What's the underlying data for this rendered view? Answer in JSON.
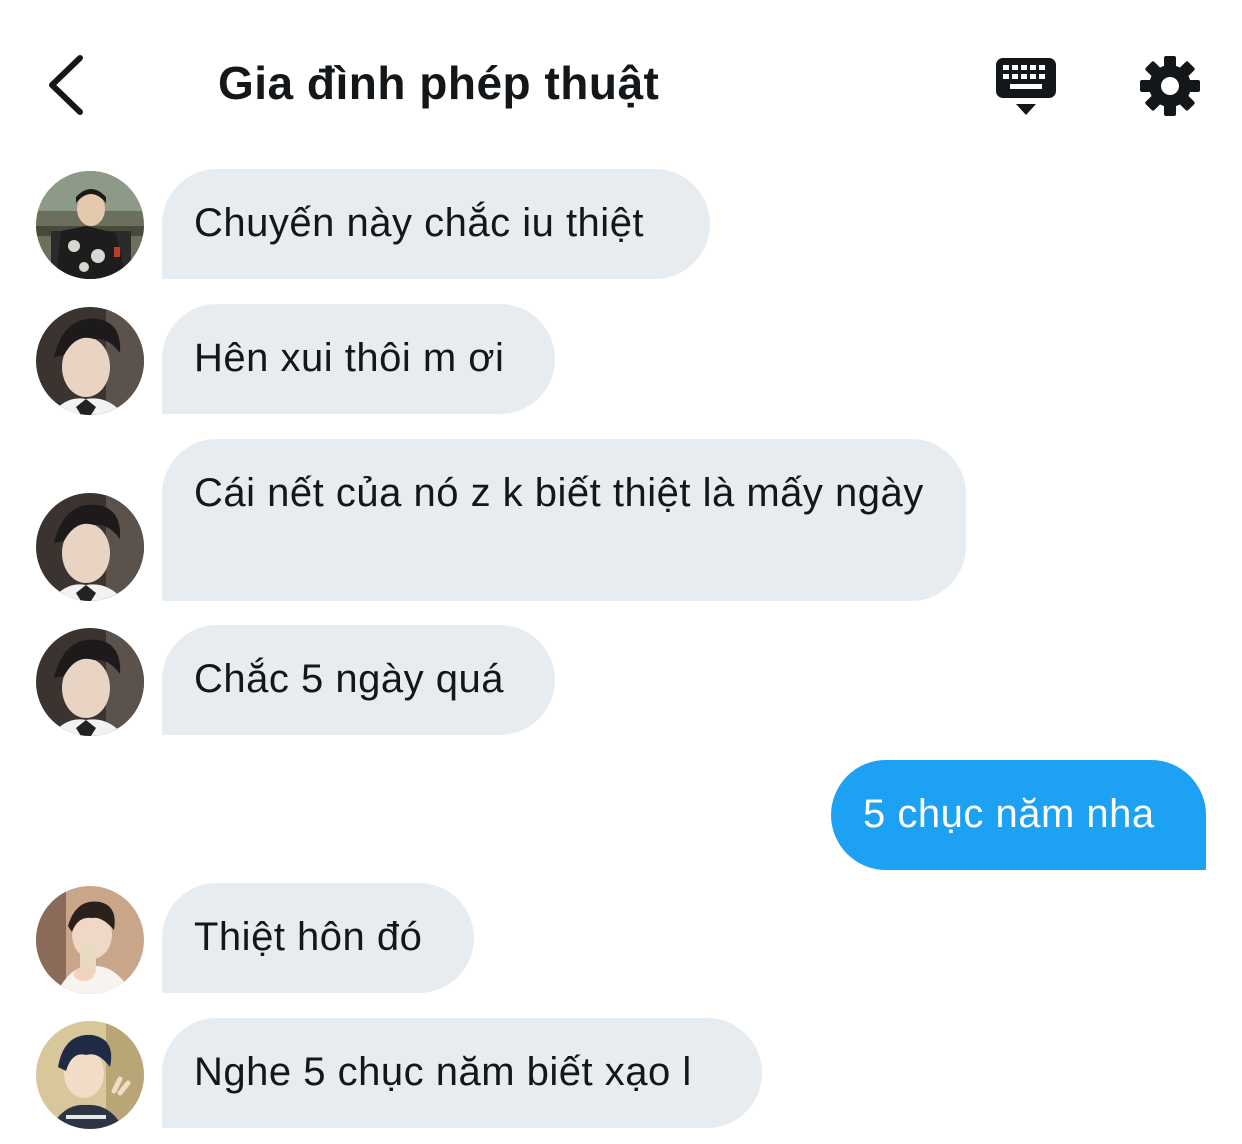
{
  "header": {
    "title": "Gia đình phép thuật",
    "back_icon": "chevron-left-icon",
    "keyboard_icon": "keyboard-icon",
    "settings_icon": "gear-icon"
  },
  "colors": {
    "incoming_bubble": "#e6ecf0",
    "outgoing_bubble": "#1da1f2",
    "text": "#14171a"
  },
  "messages": [
    {
      "direction": "incoming",
      "text": "Chuyến này chắc iu thiệt"
    },
    {
      "direction": "incoming",
      "text": "Hên xui thôi m ơi"
    },
    {
      "direction": "incoming",
      "text": "Cái nết của nó z k biết thiệt là mấy ngày"
    },
    {
      "direction": "incoming",
      "text": "Chắc 5 ngày quá"
    },
    {
      "direction": "outgoing",
      "text": "5 chục năm nha"
    },
    {
      "direction": "incoming",
      "text": "Thiệt hôn đó"
    },
    {
      "direction": "incoming",
      "text": "Nghe 5 chục năm biết xạo l"
    }
  ]
}
